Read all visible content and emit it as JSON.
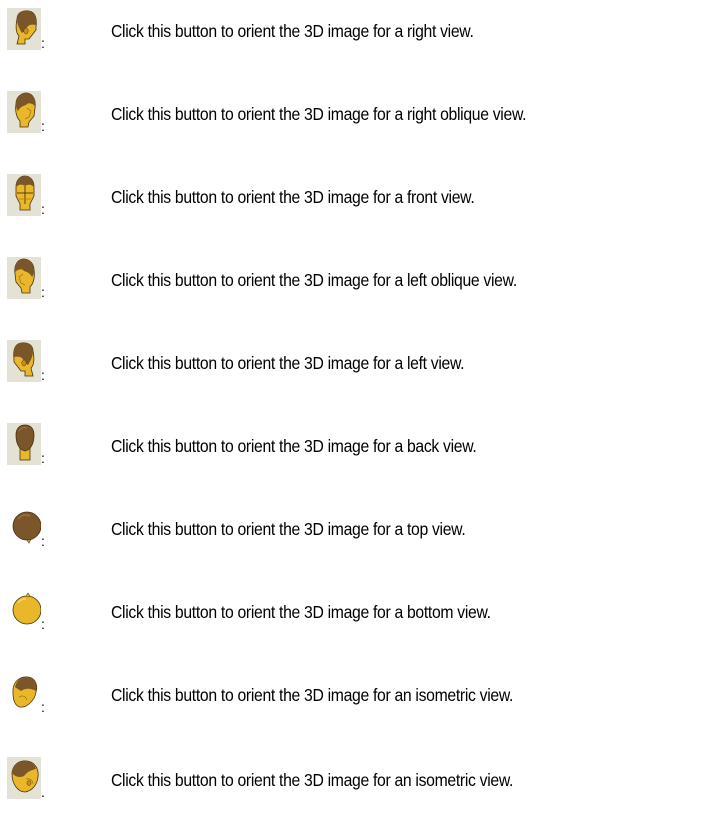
{
  "views": [
    {
      "icon": "head-right-view-icon",
      "button": "right-view-button",
      "separator": ":",
      "description": "Click this button to orient the 3D image for a right view."
    },
    {
      "icon": "head-right-oblique-view-icon",
      "button": "right-oblique-view-button",
      "separator": ":",
      "description": "Click this button to orient the 3D image for a right oblique view."
    },
    {
      "icon": "head-front-view-icon",
      "button": "front-view-button",
      "separator": ":",
      "description": "Click this button to orient the 3D image for a front view."
    },
    {
      "icon": "head-left-oblique-view-icon",
      "button": "left-oblique-view-button",
      "separator": ":",
      "description": "Click this button to orient the 3D image for a left oblique view."
    },
    {
      "icon": "head-left-view-icon",
      "button": "left-view-button",
      "separator": ":",
      "description": "Click this button to orient the 3D image for a left view."
    },
    {
      "icon": "head-back-view-icon",
      "button": "back-view-button",
      "separator": ":",
      "description": "Click this button to orient the 3D image for a back view."
    },
    {
      "icon": "head-top-view-icon",
      "button": "top-view-button",
      "separator": ":",
      "description": "Click this button to orient the 3D image for a top view."
    },
    {
      "icon": "head-bottom-view-icon",
      "button": "bottom-view-button",
      "separator": ":",
      "description": "Click this button to orient the 3D image for a bottom view."
    },
    {
      "icon": "head-isometric-view-icon",
      "button": "isometric-view-button",
      "separator": ":",
      "description": "Click this button to orient the 3D image for an isometric view."
    },
    {
      "icon": "head-isometric-view-alt-icon",
      "button": "isometric-view-alt-button",
      "separator": ".",
      "description": "Click this button to orient the 3D image for an isometric view."
    }
  ],
  "colors": {
    "button_face": "#e4e2d4",
    "hair": "#7a5628",
    "skin": "#e8b82a",
    "outline": "#4a3210"
  }
}
